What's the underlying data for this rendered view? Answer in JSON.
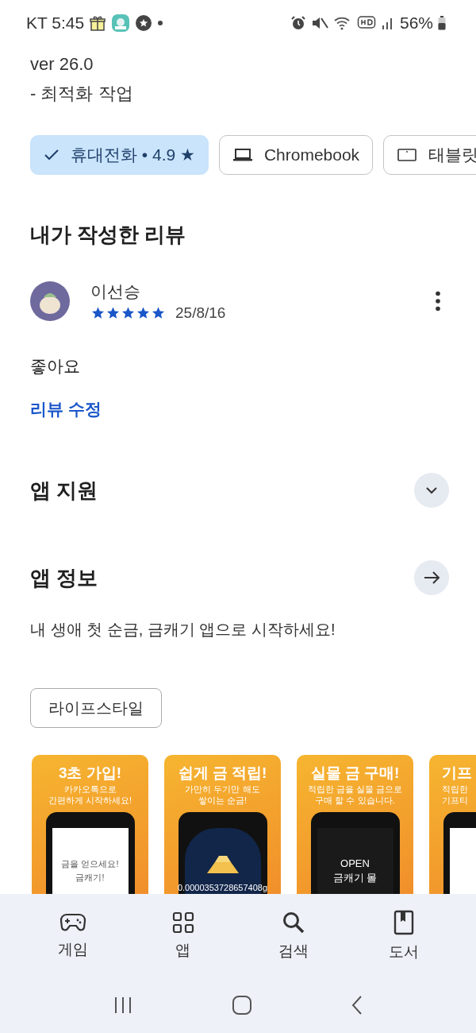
{
  "status_bar": {
    "carrier_time": "KT 5:45",
    "battery": "56%"
  },
  "whats_new": {
    "version": "ver 26.0",
    "note": "- 최적화 작업"
  },
  "device_chips": [
    {
      "label": "휴대전화 • 4.9 ★",
      "selected": true
    },
    {
      "kind": "laptop",
      "label": "Chromebook",
      "selected": false
    },
    {
      "kind": "tablet",
      "label": "태블릿",
      "selected": false
    }
  ],
  "my_review": {
    "heading": "내가 작성한 리뷰",
    "author": "이선승",
    "stars": 5,
    "date": "25/8/16",
    "text": "좋아요",
    "edit_link": "리뷰 수정"
  },
  "sections": [
    {
      "kind": "expand",
      "title": "앱 지원"
    },
    {
      "kind": "arrow",
      "title": "앱 정보"
    }
  ],
  "description": "내 생애 첫 순금, 금캐기 앱으로 시작하세요!",
  "category": "라이프스타일",
  "screenshots": [
    {
      "kind": "light",
      "title": "3초 가입!",
      "subtitle": [
        "카카오톡으로",
        "간편하게 시작하세요!"
      ],
      "screen_texts": [
        "금을 얻으세요!",
        "금캐기!"
      ]
    },
    {
      "kind": "coin",
      "title": "쉽게 금 적립!",
      "subtitle": [
        "가만히 두기만 해도",
        "쌓이는 순금!"
      ],
      "screen_texts": [
        "0.0000353728657408g"
      ]
    },
    {
      "kind": "dark",
      "title": "실물 금 구매!",
      "subtitle": [
        "적립한 금을 실물 금으로",
        "구매 할 수 있습니다."
      ],
      "screen_texts": [
        "OPEN",
        "금캐기 몰"
      ]
    },
    {
      "kind": "light",
      "title": "기프",
      "subtitle": [
        "적립한",
        "기프티"
      ]
    }
  ],
  "bottom_nav": [
    {
      "kind": "games",
      "label": "게임"
    },
    {
      "kind": "apps",
      "label": "앱"
    },
    {
      "kind": "search",
      "label": "검색"
    },
    {
      "kind": "books",
      "label": "도서"
    }
  ]
}
